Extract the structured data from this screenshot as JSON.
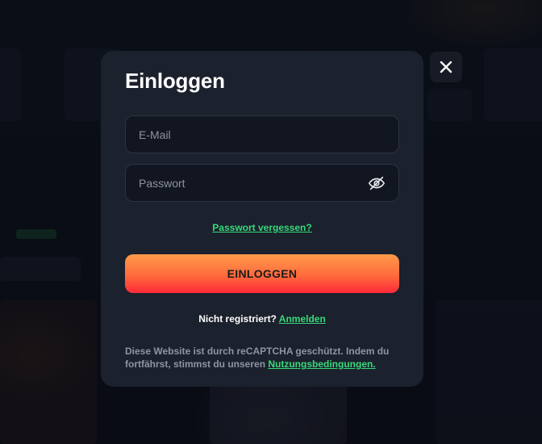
{
  "modal": {
    "title": "Einloggen",
    "close_icon": "close-icon"
  },
  "form": {
    "email_placeholder": "E-Mail",
    "email_value": "",
    "password_placeholder": "Passwort",
    "password_value": "",
    "password_toggle_icon": "eye-off-icon",
    "forgot_label": "Passwort vergessen?",
    "login_label": "EINLOGGEN"
  },
  "register": {
    "prompt": "Nicht registriert?",
    "link_label": "Anmelden"
  },
  "legal": {
    "text": "Diese Website ist durch reCAPTCHA geschützt. Indem du fortfährst, stimmst du unseren",
    "link_label": "Nutzungsbedingungen."
  },
  "colors": {
    "accent_green": "#38d97a",
    "button_gradient_top": "#ff9a4a",
    "button_gradient_bottom": "#ff2a3a",
    "modal_background": "#1b212d"
  }
}
